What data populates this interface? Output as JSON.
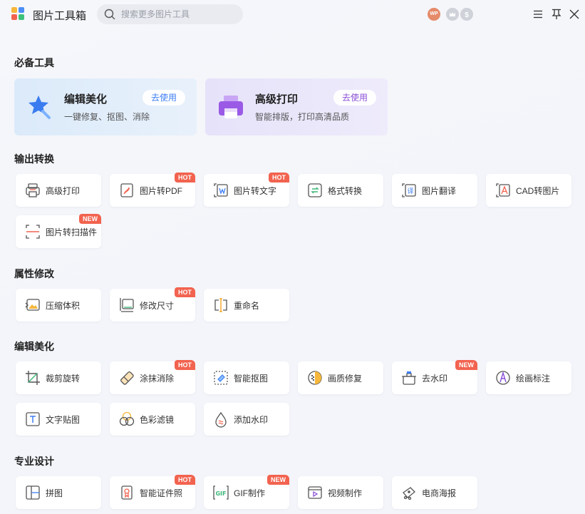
{
  "app": {
    "title": "图片工具箱"
  },
  "search": {
    "placeholder": "搜索更多图片工具"
  },
  "titlebar": {
    "avatar_text": "WP"
  },
  "colors": {
    "accent_blue": "#3d7ef5",
    "accent_purple": "#8a4fd8",
    "tag_red": "#f2634f"
  },
  "essentials": {
    "title": "必备工具",
    "cards": [
      {
        "title": "编辑美化",
        "desc": "一键修复、抠图、消除",
        "button": "去使用",
        "icon": "magic-wand-icon"
      },
      {
        "title": "高级打印",
        "desc": "智能排版，打印高清品质",
        "button": "去使用",
        "icon": "printer-icon"
      }
    ]
  },
  "sections": [
    {
      "title": "输出转换",
      "tools": [
        {
          "label": "高级打印",
          "icon": "printer-icon",
          "tag": ""
        },
        {
          "label": "图片转PDF",
          "icon": "pdf-icon",
          "tag": "HOT"
        },
        {
          "label": "图片转文字",
          "icon": "text-extract-icon",
          "tag": "HOT"
        },
        {
          "label": "格式转换",
          "icon": "format-convert-icon",
          "tag": ""
        },
        {
          "label": "图片翻译",
          "icon": "translate-icon",
          "tag": ""
        },
        {
          "label": "CAD转图片",
          "icon": "cad-icon",
          "tag": ""
        },
        {
          "label": "图片转扫描件",
          "icon": "scan-icon",
          "tag": "NEW"
        }
      ]
    },
    {
      "title": "属性修改",
      "tools": [
        {
          "label": "压缩体积",
          "icon": "compress-icon",
          "tag": ""
        },
        {
          "label": "修改尺寸",
          "icon": "resize-icon",
          "tag": "HOT"
        },
        {
          "label": "重命名",
          "icon": "rename-icon",
          "tag": ""
        }
      ]
    },
    {
      "title": "编辑美化",
      "tools": [
        {
          "label": "裁剪旋转",
          "icon": "crop-icon",
          "tag": ""
        },
        {
          "label": "涂抹消除",
          "icon": "eraser-icon",
          "tag": "HOT"
        },
        {
          "label": "智能抠图",
          "icon": "cutout-icon",
          "tag": ""
        },
        {
          "label": "画质修复",
          "icon": "quality-icon",
          "tag": ""
        },
        {
          "label": "去水印",
          "icon": "remove-watermark-icon",
          "tag": "NEW"
        },
        {
          "label": "绘画标注",
          "icon": "draw-icon",
          "tag": ""
        },
        {
          "label": "文字贴图",
          "icon": "text-icon",
          "tag": ""
        },
        {
          "label": "色彩滤镜",
          "icon": "filter-icon",
          "tag": ""
        },
        {
          "label": "添加水印",
          "icon": "add-watermark-icon",
          "tag": ""
        }
      ]
    },
    {
      "title": "专业设计",
      "tools": [
        {
          "label": "拼图",
          "icon": "collage-icon",
          "tag": ""
        },
        {
          "label": "智能证件照",
          "icon": "id-photo-icon",
          "tag": "HOT"
        },
        {
          "label": "GIF制作",
          "icon": "gif-icon",
          "tag": "NEW"
        },
        {
          "label": "视频制作",
          "icon": "video-icon",
          "tag": ""
        },
        {
          "label": "电商海报",
          "icon": "poster-icon",
          "tag": ""
        }
      ]
    }
  ]
}
